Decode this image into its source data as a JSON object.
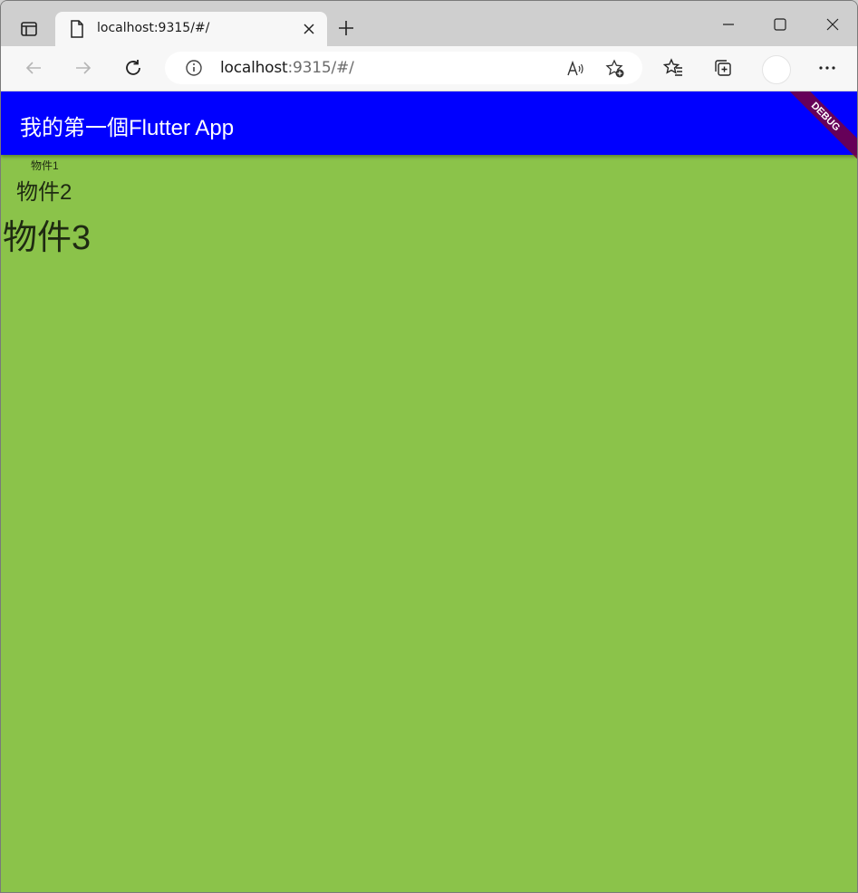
{
  "browser": {
    "tab": {
      "title": "localhost:9315/#/"
    },
    "address": {
      "host": "localhost",
      "rest": ":9315/#/"
    }
  },
  "app": {
    "title": "我的第一個Flutter App",
    "debug_label": "DEBUG",
    "items": [
      "物件1",
      "物件2",
      "物件3"
    ],
    "colors": {
      "appbar": "#0000ff",
      "background": "#8bc34a"
    }
  },
  "icons": {
    "tab_actions": "tab-actions-icon",
    "page": "page-icon",
    "close": "close-icon",
    "new_tab": "plus-icon",
    "minimize": "minimize-icon",
    "maximize": "maximize-icon",
    "window_close": "window-close-icon",
    "back": "back-arrow-icon",
    "forward": "forward-arrow-icon",
    "refresh": "refresh-icon",
    "info": "info-icon",
    "read_aloud": "read-aloud-icon",
    "add_favorite": "add-favorite-icon",
    "favorites": "favorites-icon",
    "collections": "collections-icon",
    "more": "more-icon"
  }
}
